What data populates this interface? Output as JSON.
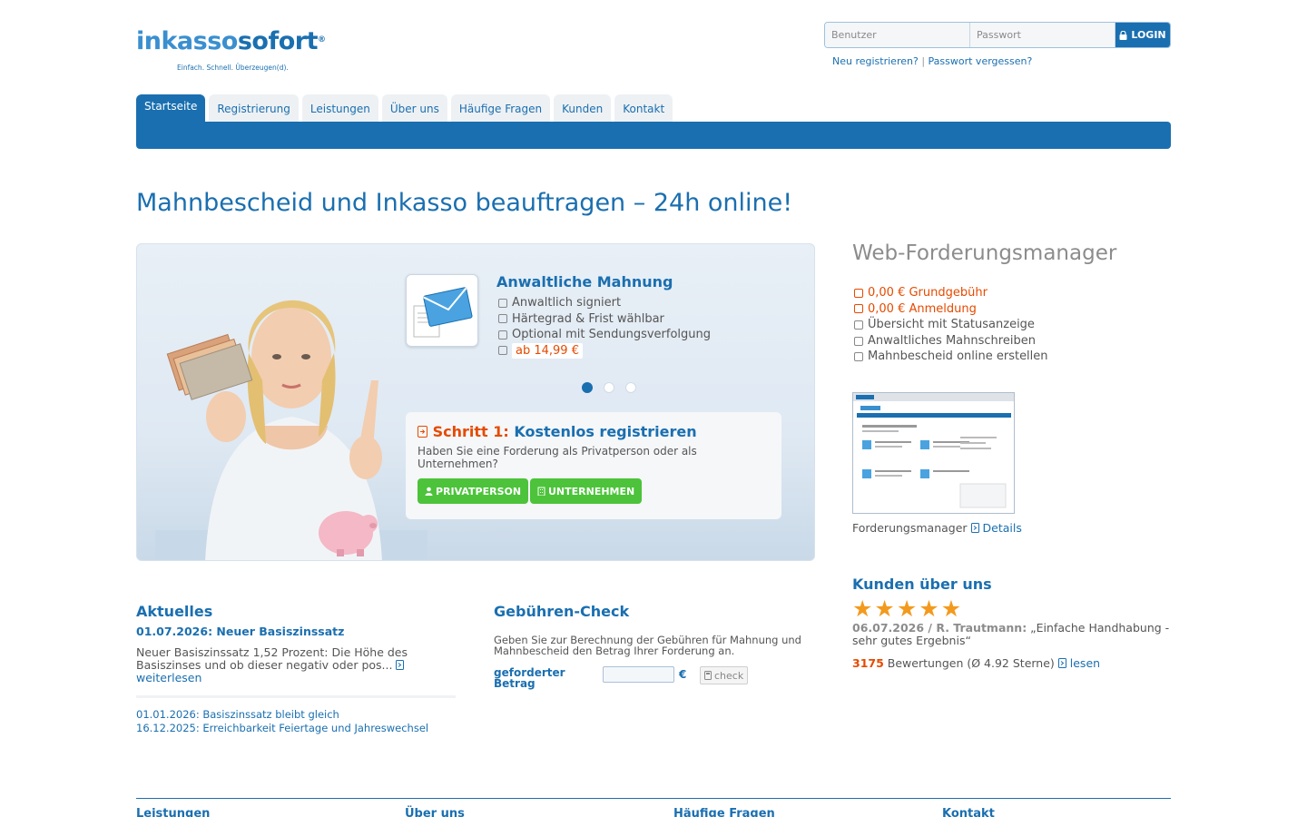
{
  "brand": {
    "logo_part1": "inkasso",
    "logo_part2": "fort",
    "logo_prefix": "so",
    "registered": "®",
    "tagline": "Einfach. Schnell. Überzeugen(d).",
    "primary_color": "#1a6fb0",
    "accent_color": "#e64a00",
    "success_color": "#4cc33a"
  },
  "login": {
    "user_placeholder": "Benutzer",
    "password_placeholder": "Passwort",
    "button_icon": "lock-icon",
    "button_label": "LOGIN",
    "register_link": "Neu registrieren?",
    "separator": "|",
    "forgot_link": "Passwort vergessen?"
  },
  "nav": {
    "tabs": [
      {
        "label": "Startseite",
        "active": true
      },
      {
        "label": "Registrierung"
      },
      {
        "label": "Leistungen"
      },
      {
        "label": "Über uns"
      },
      {
        "label": "Häufige Fragen"
      },
      {
        "label": "Kunden"
      },
      {
        "label": "Kontakt"
      }
    ]
  },
  "headline": "Mahnbescheid und Inkasso beauftragen – 24h online!",
  "hero": {
    "icon": "envelope-letter-icon",
    "title": "Anwaltliche Mahnung",
    "features": [
      "Anwaltlich signiert",
      "Härtegrad & Frist wählbar",
      "Optional mit Sendungsverfolgung"
    ],
    "price": "ab 14,99 €",
    "slides_total": 3,
    "slide_active": 1,
    "step_icon": "arrow-right-icon",
    "step_prefix": "Schritt 1:",
    "step_title": "Kostenlos registrieren",
    "step_text": "Haben Sie eine Forderung als Privatperson oder als Unternehmen?",
    "btn_private": "PRIVATPERSON",
    "btn_company": "UNTERNEHMEN"
  },
  "web_manager": {
    "title": "Web-Forderungsmanager",
    "features_highlight": [
      "0,00 € Grundgebühr",
      "0,00 € Anmeldung"
    ],
    "features": [
      "Übersicht mit Statusanzeige",
      "Anwaltliches Mahnschreiben",
      "Mahnbescheid online erstellen"
    ],
    "caption": "Forderungsmanager",
    "details_link": "Details"
  },
  "news": {
    "title": "Aktuelles",
    "headline_date_title": "01.07.2026: Neuer Basiszinssatz",
    "text": "Neuer Basiszinssatz 1,52 Prozent: Die Höhe des Basiszinses und ob dieser negativ oder pos...",
    "read_more": "weiterlesen",
    "items": [
      "01.01.2026: Basiszinssatz bleibt gleich",
      "16.12.2025: Erreichbarkeit Feiertage und Jahreswechsel"
    ]
  },
  "fee_check": {
    "title": "Gebühren-Check",
    "text": "Geben Sie zur Berechnung der Gebühren für Mahnung und Mahnbescheid den Betrag Ihrer Forderung an.",
    "label": "geforderter Betrag",
    "currency": "€",
    "button": "check",
    "value": ""
  },
  "customers": {
    "title": "Kunden über uns",
    "rating_stars": 5,
    "review_meta": "06.07.2026 / R. Trautmann:",
    "review_text": "„Einfache Handhabung - sehr gutes Ergebnis“",
    "count": "3175",
    "count_text": "Bewertungen (Ø 4.92 Sterne)",
    "read_link": "lesen"
  },
  "footer": {
    "headings": [
      "Leistungen",
      "Über uns",
      "Häufige Fragen",
      "Kontakt"
    ]
  }
}
